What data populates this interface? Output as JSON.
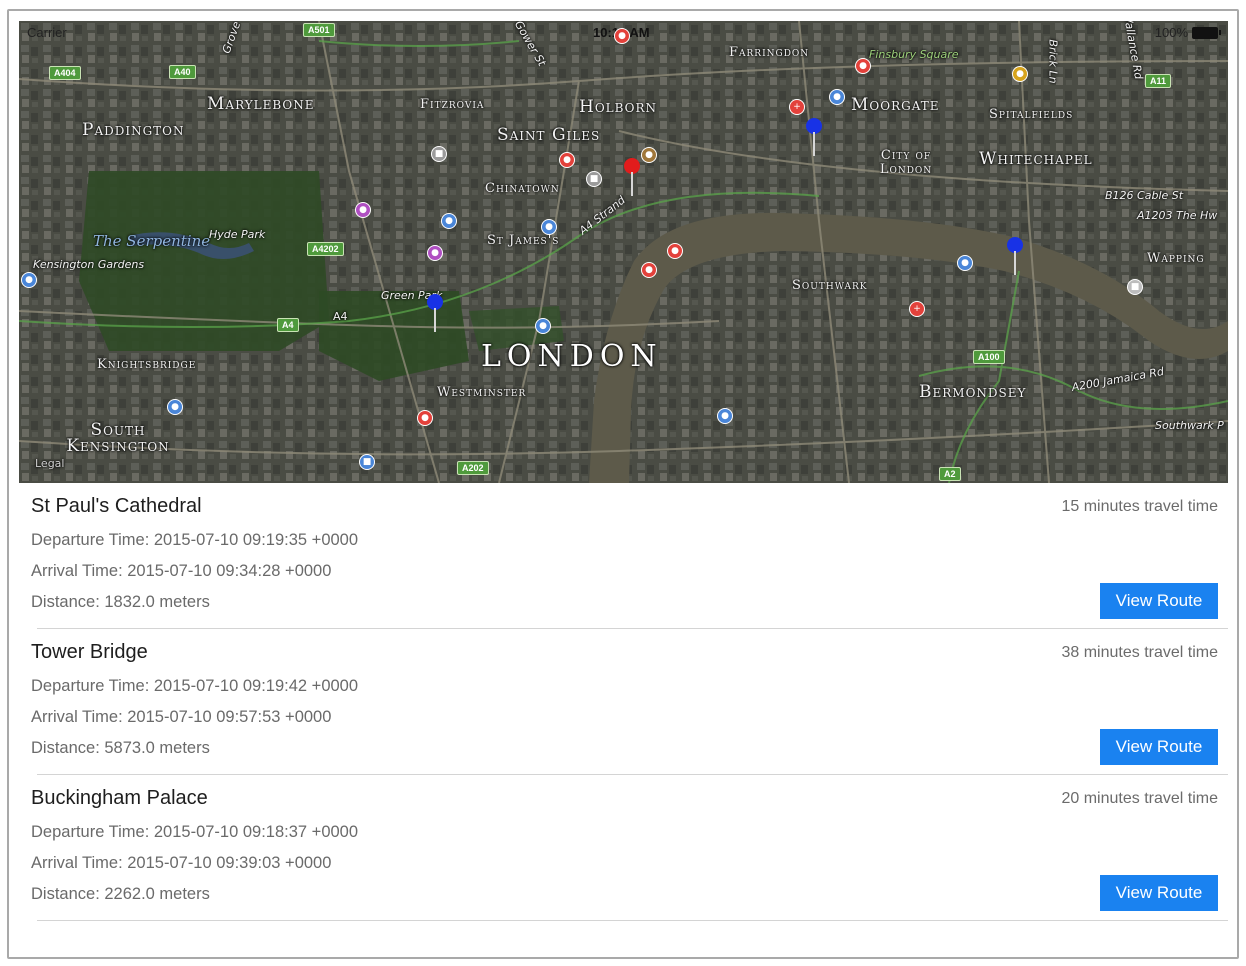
{
  "status_bar": {
    "carrier": "Carrier",
    "time": "10:15 AM",
    "battery": "100%"
  },
  "map": {
    "district_labels": [
      "Marylebone",
      "Paddington",
      "Fitzrovia",
      "Holborn",
      "Saint Giles",
      "Farringdon",
      "Moorgate",
      "Whitechapel",
      "City of London",
      "Chinatown",
      "St James's",
      "Southwark",
      "Knightsbridge",
      "Westminster",
      "Bermondsey",
      "South Kensington",
      "Wapping",
      "Spitalfields",
      "Kensington Gardens"
    ],
    "city_label": "LONDON",
    "water_label": "The Serpentine",
    "park_labels": [
      "Hyde Park",
      "Green Park"
    ],
    "street_labels": [
      "Gower St",
      "A4 Strand",
      "Brick Ln",
      "Vallance Rd",
      "B126 Cable St",
      "A1203 The Hw",
      "A200 Jamaica Rd",
      "Southwark P",
      "Finsbury Square",
      "Grove"
    ],
    "road_badges": [
      "A501",
      "A404",
      "A40",
      "A4202",
      "A4",
      "A4",
      "A100",
      "A202",
      "A2",
      "A11"
    ],
    "legal": "Legal"
  },
  "routes": [
    {
      "title": "St Paul's Cathedral",
      "travel": "15 minutes travel time",
      "departure": "Departure Time: 2015-07-10 09:19:35 +0000",
      "arrival": "Arrival Time: 2015-07-10 09:34:28 +0000",
      "distance": "Distance: 1832.0 meters",
      "button": "View Route"
    },
    {
      "title": "Tower Bridge",
      "travel": "38 minutes travel time",
      "departure": "Departure Time: 2015-07-10 09:19:42 +0000",
      "arrival": "Arrival Time: 2015-07-10 09:57:53 +0000",
      "distance": "Distance: 5873.0 meters",
      "button": "View Route"
    },
    {
      "title": "Buckingham Palace",
      "travel": "20 minutes travel time",
      "departure": "Departure Time: 2015-07-10 09:18:37 +0000",
      "arrival": "Arrival Time: 2015-07-10 09:39:03 +0000",
      "distance": "Distance: 2262.0 meters",
      "button": "View Route"
    }
  ],
  "colors": {
    "button": "#1a82f0",
    "pin_blue": "#1832e6",
    "pin_red": "#e21c1c"
  }
}
